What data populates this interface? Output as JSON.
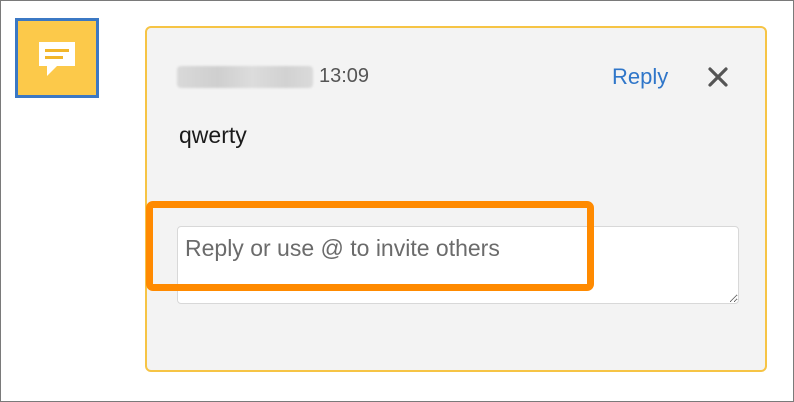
{
  "comment": {
    "time": "13:09",
    "reply_label": "Reply",
    "text": "qwerty",
    "reply_placeholder": "Reply or use @ to invite others"
  },
  "icons": {
    "marker": "comment-icon",
    "close": "close-icon"
  },
  "colors": {
    "marker_bg": "#fcc94a",
    "marker_border": "#3b78c4",
    "card_border": "#f6c445",
    "link": "#2f76c9",
    "highlight": "#ff8a00"
  }
}
